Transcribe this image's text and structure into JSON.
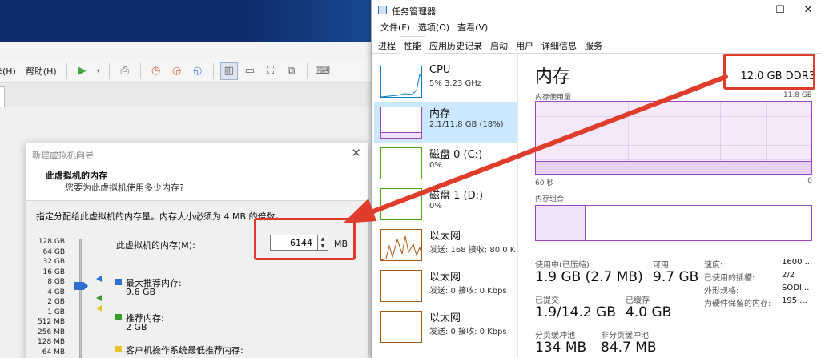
{
  "vm_app": {
    "menu_partial": "卡(H)",
    "menu_help": "帮助(H)"
  },
  "wizard": {
    "title": "新建虚拟机向导",
    "heading": "此虚拟机的内存",
    "subtitle": "您要为此虚拟机使用多少内存?",
    "instruction": "指定分配给此虚拟机的内存量。内存大小必须为 4 MB 的倍数。",
    "memory_label": "此虚拟机的内存(M):",
    "memory_value": "6144",
    "memory_unit": "MB",
    "scale_labels": [
      "128 GB",
      "64 GB",
      "32 GB",
      "16 GB",
      "8 GB",
      "4 GB",
      "2 GB",
      "1 GB",
      "512 MB",
      "256 MB",
      "128 MB",
      "64 MB"
    ],
    "legend": {
      "max_label": "最大推荐内存:",
      "max_value": "9.6 GB",
      "rec_label": "推荐内存:",
      "rec_value": "2 GB",
      "min_label": "客户机操作系统最低推荐内存:"
    }
  },
  "task_manager": {
    "title": "任务管理器",
    "menus": [
      "文件(F)",
      "选项(O)",
      "查看(V)"
    ],
    "tabs": [
      "进程",
      "性能",
      "应用历史记录",
      "启动",
      "用户",
      "详细信息",
      "服务"
    ],
    "active_tab": "性能",
    "sidebar": [
      {
        "name": "CPU",
        "sub": "5% 3.23 GHz"
      },
      {
        "name": "内存",
        "sub": "2.1/11.8 GB (18%)"
      },
      {
        "name": "磁盘 0 (C:)",
        "sub": "0%"
      },
      {
        "name": "磁盘 1 (D:)",
        "sub": "0%"
      },
      {
        "name": "以太网",
        "sub": "发送: 168 接收: 80.0 K"
      },
      {
        "name": "以太网",
        "sub": "发送: 0 接收: 0 Kbps"
      },
      {
        "name": "以太网",
        "sub": "发送: 0 接收: 0 Kbps"
      }
    ],
    "memory": {
      "title": "内存",
      "spec": "12.0 GB DDR3",
      "usage_label": "内存使用量",
      "usage_max": "11.8 GB",
      "axis_left": "60 秒",
      "axis_right": "0",
      "composition_label": "内存组合",
      "usage_fraction": 0.18,
      "stats": {
        "in_use_label": "使用中(已压缩)",
        "in_use_value": "1.9 GB (2.7 MB)",
        "available_label": "可用",
        "available_value": "9.7 GB",
        "committed_label": "已提交",
        "committed_value": "1.9/14.2 GB",
        "cached_label": "已缓存",
        "cached_value": "4.0 GB",
        "paged_label": "分页缓冲池",
        "paged_value": "134 MB",
        "nonpaged_label": "非分页缓冲池",
        "nonpaged_value": "84.7 MB"
      },
      "details": [
        {
          "key": "速度:",
          "value": "1600 ..."
        },
        {
          "key": "已使用的插槽:",
          "value": "2/2"
        },
        {
          "key": "外形规格:",
          "value": "SODI..."
        },
        {
          "key": "为硬件保留的内存:",
          "value": "195 ..."
        }
      ]
    }
  },
  "colors": {
    "accent_red": "#e03c2b",
    "memory_purple": "#9c46c4",
    "disk_green": "#4da60c",
    "ethernet_orange": "#a85a16",
    "cpu_blue": "#117dbb"
  }
}
